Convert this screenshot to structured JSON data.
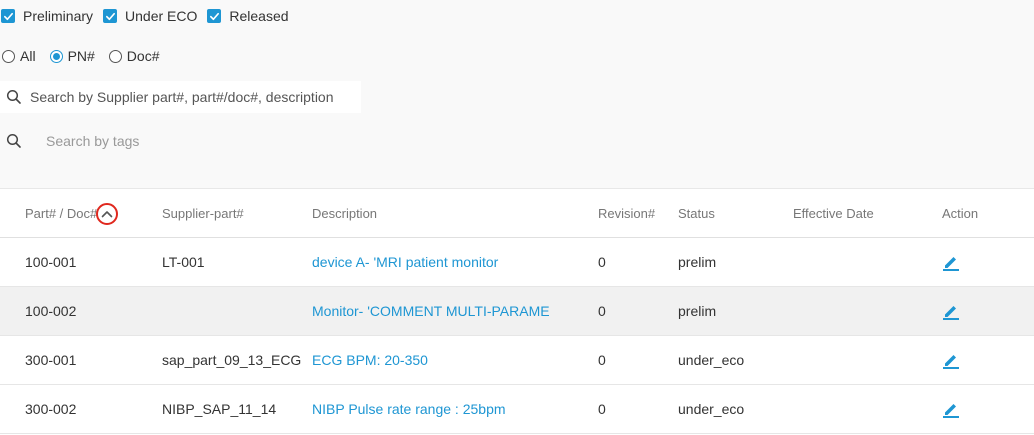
{
  "filters": {
    "status_checkboxes": [
      {
        "label": "Preliminary",
        "checked": true
      },
      {
        "label": "Under ECO",
        "checked": true
      },
      {
        "label": "Released",
        "checked": true
      }
    ],
    "search_mode": [
      {
        "label": "All",
        "selected": false
      },
      {
        "label": "PN#",
        "selected": true
      },
      {
        "label": "Doc#",
        "selected": false
      }
    ],
    "search_placeholder": "Search by Supplier part#, part#/doc#, description",
    "tags_placeholder": "Search by tags"
  },
  "table": {
    "columns": {
      "part": "Part# / Doc#",
      "supplier": "Supplier-part#",
      "description": "Description",
      "revision": "Revision#",
      "status": "Status",
      "effective_date": "Effective Date",
      "action": "Action"
    },
    "sort": {
      "column": "part",
      "direction": "ascending"
    },
    "rows": [
      {
        "part": "100-001",
        "supplier": "LT-001",
        "description": "device A- 'MRI patient monitor",
        "revision": "0",
        "status": "prelim",
        "effective_date": ""
      },
      {
        "part": "100-002",
        "supplier": "",
        "description": "Monitor- 'COMMENT MULTI-PARAME",
        "revision": "0",
        "status": "prelim",
        "effective_date": ""
      },
      {
        "part": "300-001",
        "supplier": "sap_part_09_13_ECG",
        "description": "ECG BPM: 20-350",
        "revision": "0",
        "status": "under_eco",
        "effective_date": ""
      },
      {
        "part": "300-002",
        "supplier": "NIBP_SAP_11_14",
        "description": "NIBP Pulse rate range : 25bpm",
        "revision": "0",
        "status": "under_eco",
        "effective_date": ""
      }
    ]
  },
  "icons": {
    "search": "search-icon",
    "edit": "edit-icon",
    "sort": "chevron-up-icon"
  },
  "colors": {
    "accent": "#1e96d3",
    "sort_highlight": "#e0281e",
    "alt_row": "#f1f1f1"
  }
}
